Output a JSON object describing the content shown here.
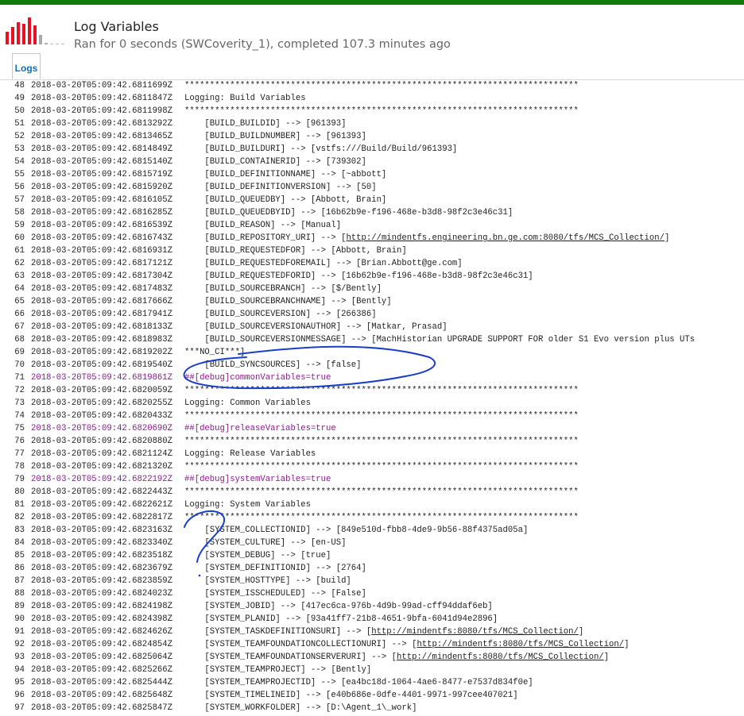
{
  "header": {
    "title": "Log Variables",
    "subtitle": "Ran for 0 seconds (SWCoverity_1), completed 107.3 minutes ago",
    "icon": "build-history-bars-icon"
  },
  "tabs": [
    {
      "label": "Logs",
      "active": true
    }
  ],
  "colors": {
    "topbar": "#107c10",
    "link": "#106ebe",
    "debug": "#8b1a8b",
    "ink": "#1a3ec8"
  },
  "log_lines": [
    {
      "n": "48",
      "ts": "2018-03-20T05:09:42.6811699Z",
      "msg": "******************************************************************************",
      "debug": false
    },
    {
      "n": "49",
      "ts": "2018-03-20T05:09:42.6811847Z",
      "msg": "Logging: Build Variables",
      "debug": false
    },
    {
      "n": "50",
      "ts": "2018-03-20T05:09:42.6811998Z",
      "msg": "******************************************************************************",
      "debug": false
    },
    {
      "n": "51",
      "ts": "2018-03-20T05:09:42.6813292Z",
      "msg": "    [BUILD_BUILDID] --> [961393]",
      "debug": false
    },
    {
      "n": "52",
      "ts": "2018-03-20T05:09:42.6813465Z",
      "msg": "    [BUILD_BUILDNUMBER] --> [961393]",
      "debug": false
    },
    {
      "n": "53",
      "ts": "2018-03-20T05:09:42.6814849Z",
      "msg": "    [BUILD_BUILDURI] --> [vstfs:///Build/Build/961393]",
      "debug": false
    },
    {
      "n": "54",
      "ts": "2018-03-20T05:09:42.6815140Z",
      "msg": "    [BUILD_CONTAINERID] --> [739302]",
      "debug": false
    },
    {
      "n": "55",
      "ts": "2018-03-20T05:09:42.6815719Z",
      "msg": "    [BUILD_DEFINITIONNAME] --> [~abbott]",
      "debug": false
    },
    {
      "n": "56",
      "ts": "2018-03-20T05:09:42.6815920Z",
      "msg": "    [BUILD_DEFINITIONVERSION] --> [50]",
      "debug": false
    },
    {
      "n": "57",
      "ts": "2018-03-20T05:09:42.6816105Z",
      "msg": "    [BUILD_QUEUEDBY] --> [Abbott, Brain]",
      "debug": false
    },
    {
      "n": "58",
      "ts": "2018-03-20T05:09:42.6816285Z",
      "msg": "    [BUILD_QUEUEDBYID] --> [16b62b9e-f196-468e-b3d8-98f2c3e46c31]",
      "debug": false
    },
    {
      "n": "59",
      "ts": "2018-03-20T05:09:42.6816539Z",
      "msg": "    [BUILD_REASON] --> [Manual]",
      "debug": false
    },
    {
      "n": "60",
      "ts": "2018-03-20T05:09:42.6816743Z",
      "pre": "    [BUILD_REPOSITORY_URI] --> [",
      "link": "http://mindentfs.engineering.bn.ge.com:8080/tfs/MCS_Collection/",
      "post": "]",
      "debug": false
    },
    {
      "n": "61",
      "ts": "2018-03-20T05:09:42.6816931Z",
      "msg": "    [BUILD_REQUESTEDFOR] --> [Abbott, Brain]",
      "debug": false
    },
    {
      "n": "62",
      "ts": "2018-03-20T05:09:42.6817121Z",
      "msg": "    [BUILD_REQUESTEDFOREMAIL] --> [Brian.Abbott@ge.com]",
      "debug": false
    },
    {
      "n": "63",
      "ts": "2018-03-20T05:09:42.6817304Z",
      "msg": "    [BUILD_REQUESTEDFORID] --> [16b62b9e-f196-468e-b3d8-98f2c3e46c31]",
      "debug": false
    },
    {
      "n": "64",
      "ts": "2018-03-20T05:09:42.6817483Z",
      "msg": "    [BUILD_SOURCEBRANCH] --> [$/Bently]",
      "debug": false
    },
    {
      "n": "65",
      "ts": "2018-03-20T05:09:42.6817666Z",
      "msg": "    [BUILD_SOURCEBRANCHNAME] --> [Bently]",
      "debug": false
    },
    {
      "n": "66",
      "ts": "2018-03-20T05:09:42.6817941Z",
      "msg": "    [BUILD_SOURCEVERSION] --> [266386]",
      "debug": false
    },
    {
      "n": "67",
      "ts": "2018-03-20T05:09:42.6818133Z",
      "msg": "    [BUILD_SOURCEVERSIONAUTHOR] --> [Matkar, Prasad]",
      "debug": false
    },
    {
      "n": "68",
      "ts": "2018-03-20T05:09:42.6818983Z",
      "msg": "    [BUILD_SOURCEVERSIONMESSAGE] --> [MachHistorian UPGRADE SUPPORT FOR older S1 Evo version plus UTs",
      "debug": false
    },
    {
      "n": "69",
      "ts": "2018-03-20T05:09:42.6819202Z",
      "msg": "***NO_CI***]",
      "debug": false
    },
    {
      "n": "70",
      "ts": "2018-03-20T05:09:42.6819540Z",
      "msg": "    [BUILD_SYNCSOURCES] --> [false]",
      "debug": false
    },
    {
      "n": "71",
      "ts": "2018-03-20T05:09:42.6819861Z",
      "msg": "##[debug]commonVariables=true",
      "debug": true
    },
    {
      "n": "72",
      "ts": "2018-03-20T05:09:42.6820059Z",
      "msg": "******************************************************************************",
      "debug": false
    },
    {
      "n": "73",
      "ts": "2018-03-20T05:09:42.6820255Z",
      "msg": "Logging: Common Variables",
      "debug": false
    },
    {
      "n": "74",
      "ts": "2018-03-20T05:09:42.6820433Z",
      "msg": "******************************************************************************",
      "debug": false
    },
    {
      "n": "75",
      "ts": "2018-03-20T05:09:42.6820690Z",
      "msg": "##[debug]releaseVariables=true",
      "debug": true
    },
    {
      "n": "76",
      "ts": "2018-03-20T05:09:42.6820880Z",
      "msg": "******************************************************************************",
      "debug": false
    },
    {
      "n": "77",
      "ts": "2018-03-20T05:09:42.6821124Z",
      "msg": "Logging: Release Variables",
      "debug": false
    },
    {
      "n": "78",
      "ts": "2018-03-20T05:09:42.6821320Z",
      "msg": "******************************************************************************",
      "debug": false
    },
    {
      "n": "79",
      "ts": "2018-03-20T05:09:42.6822192Z",
      "msg": "##[debug]systemVariables=true",
      "debug": true
    },
    {
      "n": "80",
      "ts": "2018-03-20T05:09:42.6822443Z",
      "msg": "******************************************************************************",
      "debug": false
    },
    {
      "n": "81",
      "ts": "2018-03-20T05:09:42.6822621Z",
      "msg": "Logging: System Variables",
      "debug": false
    },
    {
      "n": "82",
      "ts": "2018-03-20T05:09:42.6822817Z",
      "msg": "******************************************************************************",
      "debug": false
    },
    {
      "n": "83",
      "ts": "2018-03-20T05:09:42.6823163Z",
      "msg": "    [SYSTEM_COLLECTIONID] --> [849e510d-fbb8-4de9-9b56-88f4375ad05a]",
      "debug": false
    },
    {
      "n": "84",
      "ts": "2018-03-20T05:09:42.6823340Z",
      "msg": "    [SYSTEM_CULTURE] --> [en-US]",
      "debug": false
    },
    {
      "n": "85",
      "ts": "2018-03-20T05:09:42.6823518Z",
      "msg": "    [SYSTEM_DEBUG] --> [true]",
      "debug": false
    },
    {
      "n": "86",
      "ts": "2018-03-20T05:09:42.6823679Z",
      "msg": "    [SYSTEM_DEFINITIONID] --> [2764]",
      "debug": false
    },
    {
      "n": "87",
      "ts": "2018-03-20T05:09:42.6823859Z",
      "msg": "    [SYSTEM_HOSTTYPE] --> [build]",
      "debug": false
    },
    {
      "n": "88",
      "ts": "2018-03-20T05:09:42.6824023Z",
      "msg": "    [SYSTEM_ISSCHEDULED] --> [False]",
      "debug": false
    },
    {
      "n": "89",
      "ts": "2018-03-20T05:09:42.6824198Z",
      "msg": "    [SYSTEM_JOBID] --> [417ec6ca-976b-4d9b-99ad-cff94ddaf6eb]",
      "debug": false
    },
    {
      "n": "90",
      "ts": "2018-03-20T05:09:42.6824398Z",
      "msg": "    [SYSTEM_PLANID] --> [93a41ff7-21b8-4651-9bfa-6041d94e2896]",
      "debug": false
    },
    {
      "n": "91",
      "ts": "2018-03-20T05:09:42.6824626Z",
      "pre": "    [SYSTEM_TASKDEFINITIONSURI] --> [",
      "link": "http://mindentfs:8080/tfs/MCS_Collection/",
      "post": "]",
      "debug": false
    },
    {
      "n": "92",
      "ts": "2018-03-20T05:09:42.6824854Z",
      "pre": "    [SYSTEM_TEAMFOUNDATIONCOLLECTIONURI] --> [",
      "link": "http://mindentfs:8080/tfs/MCS_Collection/",
      "post": "]",
      "debug": false
    },
    {
      "n": "93",
      "ts": "2018-03-20T05:09:42.6825064Z",
      "pre": "    [SYSTEM_TEAMFOUNDATIONSERVERURI] --> [",
      "link": "http://mindentfs:8080/tfs/MCS_Collection/",
      "post": "]",
      "debug": false
    },
    {
      "n": "94",
      "ts": "2018-03-20T05:09:42.6825266Z",
      "msg": "    [SYSTEM_TEAMPROJECT] --> [Bently]",
      "debug": false
    },
    {
      "n": "95",
      "ts": "2018-03-20T05:09:42.6825444Z",
      "msg": "    [SYSTEM_TEAMPROJECTID] --> [ea4bc18d-1064-4ae6-8477-e7537d834f0e]",
      "debug": false
    },
    {
      "n": "96",
      "ts": "2018-03-20T05:09:42.6825648Z",
      "msg": "    [SYSTEM_TIMELINEID] --> [e40b686e-0dfe-4401-9971-997cee407021]",
      "debug": false
    },
    {
      "n": "97",
      "ts": "2018-03-20T05:09:42.6825847Z",
      "msg": "    [SYSTEM_WORKFOLDER] --> [D:\\Agent_1\\_work]",
      "debug": false
    }
  ]
}
